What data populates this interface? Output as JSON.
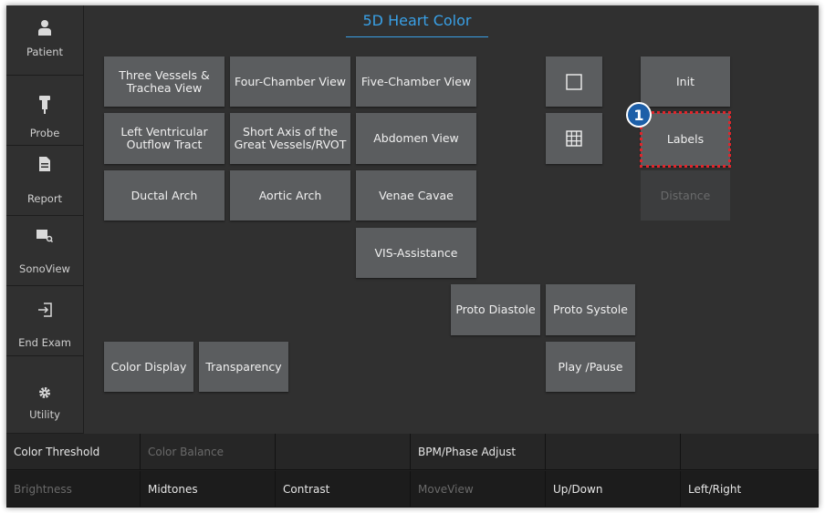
{
  "title": "5D Heart Color",
  "sidebar": {
    "items": [
      {
        "label": "Patient",
        "icon": "person-icon"
      },
      {
        "label": "Probe",
        "icon": "probe-icon"
      },
      {
        "label": "Report",
        "icon": "document-icon"
      },
      {
        "label": "SonoView",
        "icon": "sonoview-icon"
      },
      {
        "label": "End Exam",
        "icon": "exit-icon"
      },
      {
        "label": "Utility",
        "icon": "gear-icon"
      }
    ]
  },
  "views": {
    "three_vessels": "Three Vessels & Trachea View",
    "four_chamber": "Four-Chamber View",
    "five_chamber": "Five-Chamber View",
    "lvot": "Left Ventricular Outflow Tract",
    "short_axis": "Short Axis of the Great Vessels/RVOT",
    "abdomen": "Abdomen View",
    "ductal_arch": "Ductal Arch",
    "aortic_arch": "Aortic Arch",
    "venae_cavae": "Venae Cavae",
    "vis_assistance": "VIS-Assistance"
  },
  "controls": {
    "proto_diastole": "Proto Diastole",
    "proto_systole": "Proto Systole",
    "color_display": "Color Display",
    "transparency": "Transparency",
    "play_pause": "Play /Pause",
    "init": "Init",
    "labels": "Labels",
    "distance": "Distance"
  },
  "highlight_marker": "1",
  "bottom": {
    "row1": [
      "Color Threshold",
      "Color Balance",
      "",
      "BPM/Phase Adjust",
      "",
      ""
    ],
    "row2": [
      "Brightness",
      "Midtones",
      "Contrast",
      "MoveView",
      "Up/Down",
      "Left/Right"
    ]
  },
  "colors": {
    "accent": "#39a0e6",
    "highlight": "#e0252b",
    "marker": "#1d5fa8",
    "button": "#5b5d5f",
    "panel": "#303030"
  }
}
